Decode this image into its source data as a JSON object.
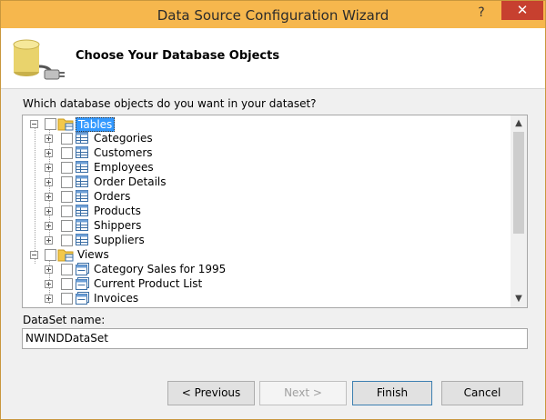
{
  "window": {
    "title": "Data Source Configuration Wizard",
    "help_label": "?",
    "close_label": "✕"
  },
  "header": {
    "title": "Choose Your Database Objects"
  },
  "prompt": "Which database objects do you want in your dataset?",
  "tree": {
    "tables_label": "Tables",
    "tables": [
      "Categories",
      "Customers",
      "Employees",
      "Order Details",
      "Orders",
      "Products",
      "Shippers",
      "Suppliers"
    ],
    "views_label": "Views",
    "views": [
      "Category Sales for 1995",
      "Current Product List",
      "Invoices"
    ],
    "scroll_up": "▲",
    "scroll_down": "▼"
  },
  "dataset": {
    "label": "DataSet name:",
    "value": "NWINDDataSet"
  },
  "buttons": {
    "previous": "< Previous",
    "next": "Next >",
    "finish": "Finish",
    "cancel": "Cancel"
  },
  "icons": {
    "header": "database-plug-icon",
    "folder": "folder-icon",
    "table": "table-icon",
    "view": "view-icon"
  },
  "colors": {
    "titlebar": "#f6b74d",
    "close": "#c7402f",
    "selection": "#3399ff"
  }
}
